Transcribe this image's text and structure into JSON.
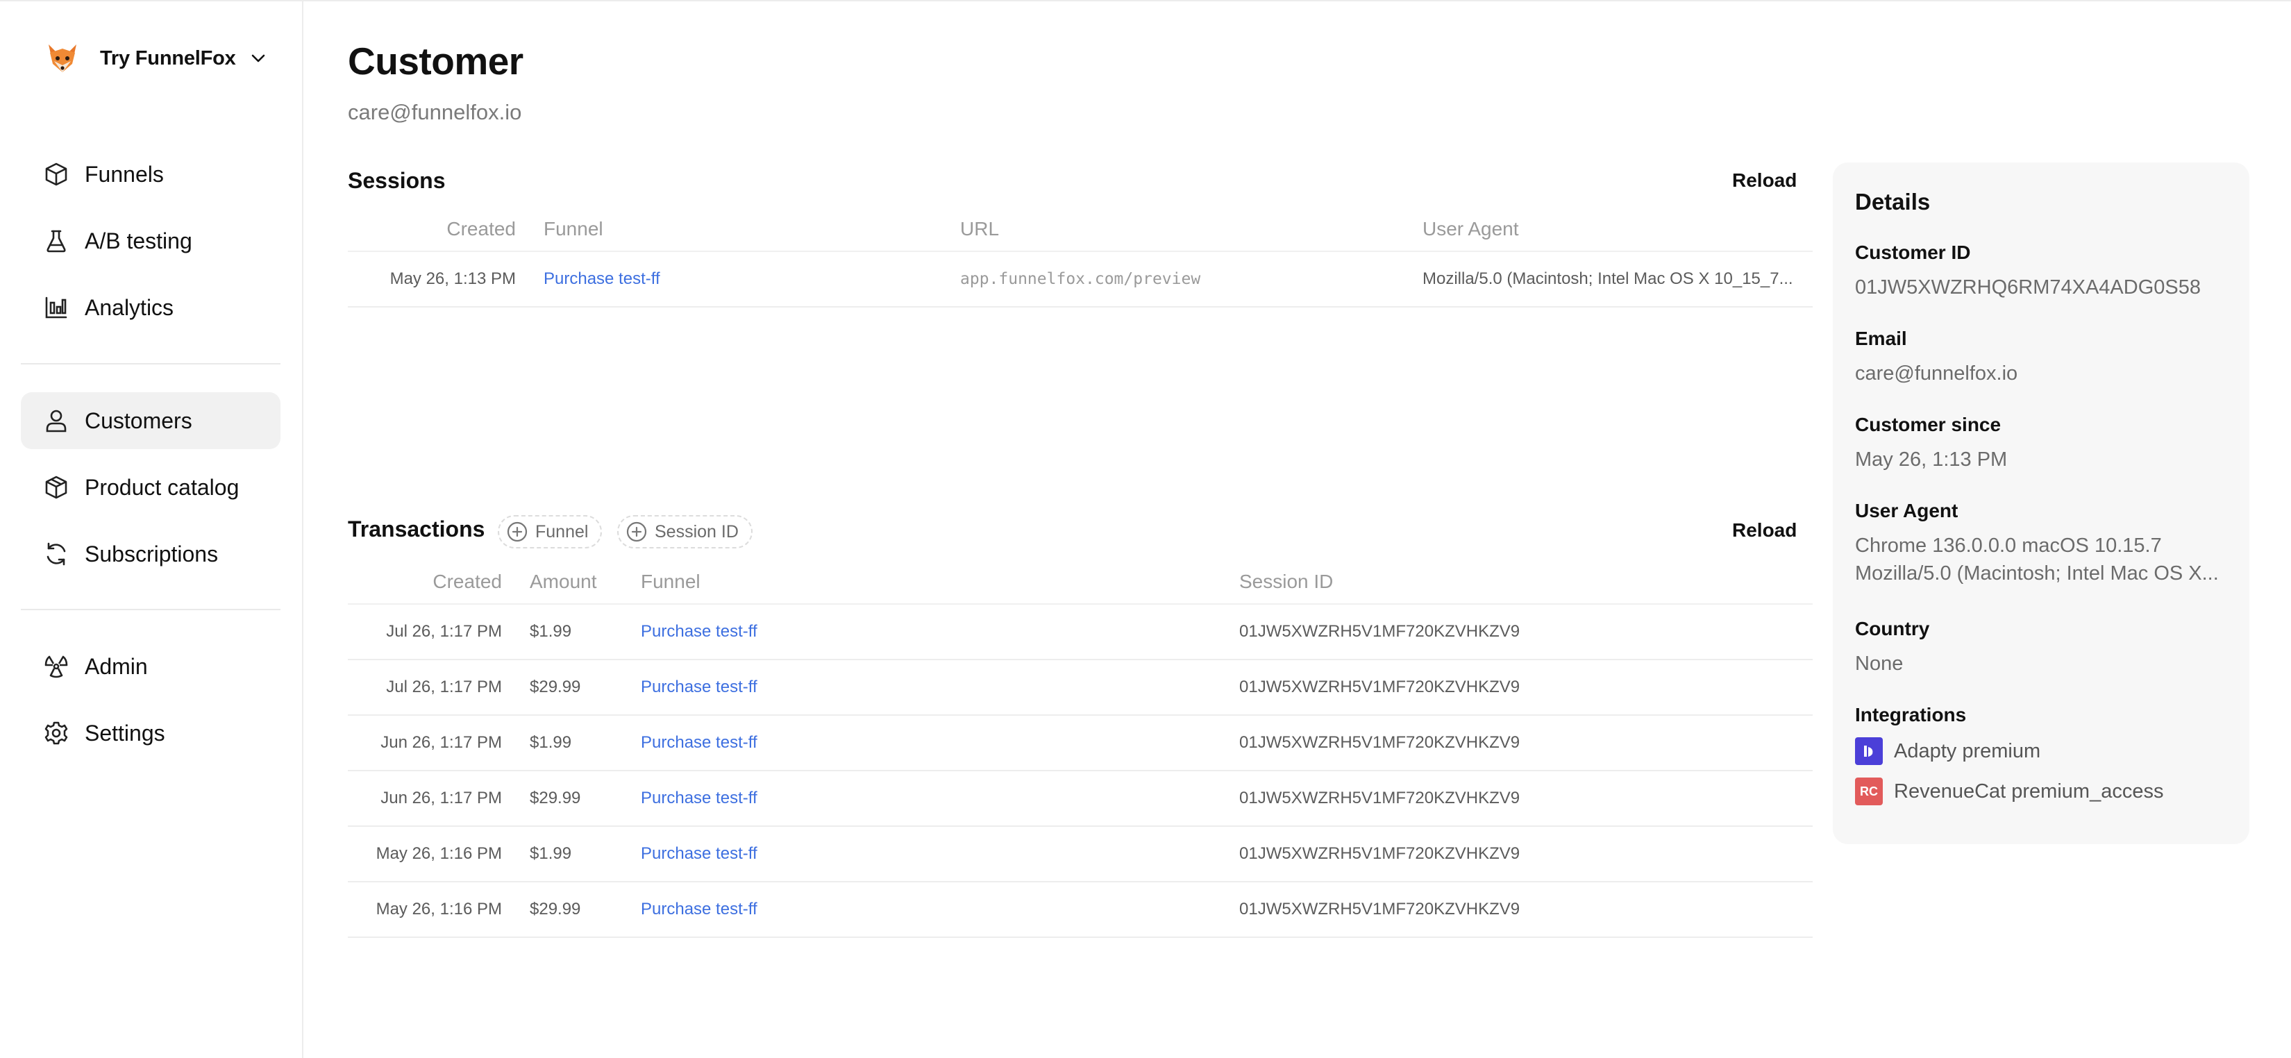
{
  "app": {
    "workspace_name": "Try FunnelFox",
    "logo_icon": "fox-logo-icon"
  },
  "sidebar": {
    "group1": [
      {
        "label": "Funnels",
        "icon": "cube-icon"
      },
      {
        "label": "A/B testing",
        "icon": "flask-icon"
      },
      {
        "label": "Analytics",
        "icon": "bar-chart-icon"
      }
    ],
    "group2": [
      {
        "label": "Customers",
        "icon": "user-icon",
        "active": true
      },
      {
        "label": "Product catalog",
        "icon": "package-icon"
      },
      {
        "label": "Subscriptions",
        "icon": "refresh-icon"
      }
    ],
    "group3": [
      {
        "label": "Admin",
        "icon": "radiation-icon"
      },
      {
        "label": "Settings",
        "icon": "gear-icon"
      }
    ]
  },
  "page": {
    "title": "Customer",
    "subtitle": "care@funnelfox.io"
  },
  "sessions": {
    "title": "Sessions",
    "reload_label": "Reload",
    "columns": [
      "Created",
      "Funnel",
      "URL",
      "User Agent"
    ],
    "rows": [
      {
        "created": "May 26, 1:13 PM",
        "funnel": "Purchase test-ff",
        "url": "app.funnelfox.com/preview",
        "user_agent": "Mozilla/5.0 (Macintosh; Intel Mac OS X 10_15_7..."
      }
    ]
  },
  "transactions": {
    "title": "Transactions",
    "reload_label": "Reload",
    "filters": [
      "Funnel",
      "Session ID"
    ],
    "columns": [
      "Created",
      "Amount",
      "Funnel",
      "Session ID"
    ],
    "rows": [
      {
        "created": "Jul 26, 1:17 PM",
        "amount": "$1.99",
        "funnel": "Purchase test-ff",
        "session_id": "01JW5XWZRH5V1MF720KZVHKZV9"
      },
      {
        "created": "Jul 26, 1:17 PM",
        "amount": "$29.99",
        "funnel": "Purchase test-ff",
        "session_id": "01JW5XWZRH5V1MF720KZVHKZV9"
      },
      {
        "created": "Jun 26, 1:17 PM",
        "amount": "$1.99",
        "funnel": "Purchase test-ff",
        "session_id": "01JW5XWZRH5V1MF720KZVHKZV9"
      },
      {
        "created": "Jun 26, 1:17 PM",
        "amount": "$29.99",
        "funnel": "Purchase test-ff",
        "session_id": "01JW5XWZRH5V1MF720KZVHKZV9"
      },
      {
        "created": "May 26, 1:16 PM",
        "amount": "$1.99",
        "funnel": "Purchase test-ff",
        "session_id": "01JW5XWZRH5V1MF720KZVHKZV9"
      },
      {
        "created": "May 26, 1:16 PM",
        "amount": "$29.99",
        "funnel": "Purchase test-ff",
        "session_id": "01JW5XWZRH5V1MF720KZVHKZV9"
      }
    ]
  },
  "details": {
    "title": "Details",
    "customer_id_label": "Customer ID",
    "customer_id": "01JW5XWZRHQ6RM74XA4ADG0S58",
    "email_label": "Email",
    "email": "care@funnelfox.io",
    "since_label": "Customer since",
    "since": "May 26, 1:13 PM",
    "ua_label": "User Agent",
    "ua_line1": "Chrome 136.0.0.0 macOS 10.15.7",
    "ua_line2": "Mozilla/5.0 (Macintosh; Intel Mac OS X...",
    "country_label": "Country",
    "country": "None",
    "integrations_label": "Integrations",
    "integrations": [
      {
        "name": "Adapty premium",
        "icon": "adapty-icon",
        "color": "#4b3fd8"
      },
      {
        "name": "RevenueCat premium_access",
        "icon": "revenuecat-icon",
        "color": "#e25b5b",
        "badge": "RC"
      }
    ]
  },
  "colors": {
    "link": "#3d6fe0",
    "active_nav_bg": "#f1f1f1",
    "panel_bg": "#f7f7f7"
  }
}
